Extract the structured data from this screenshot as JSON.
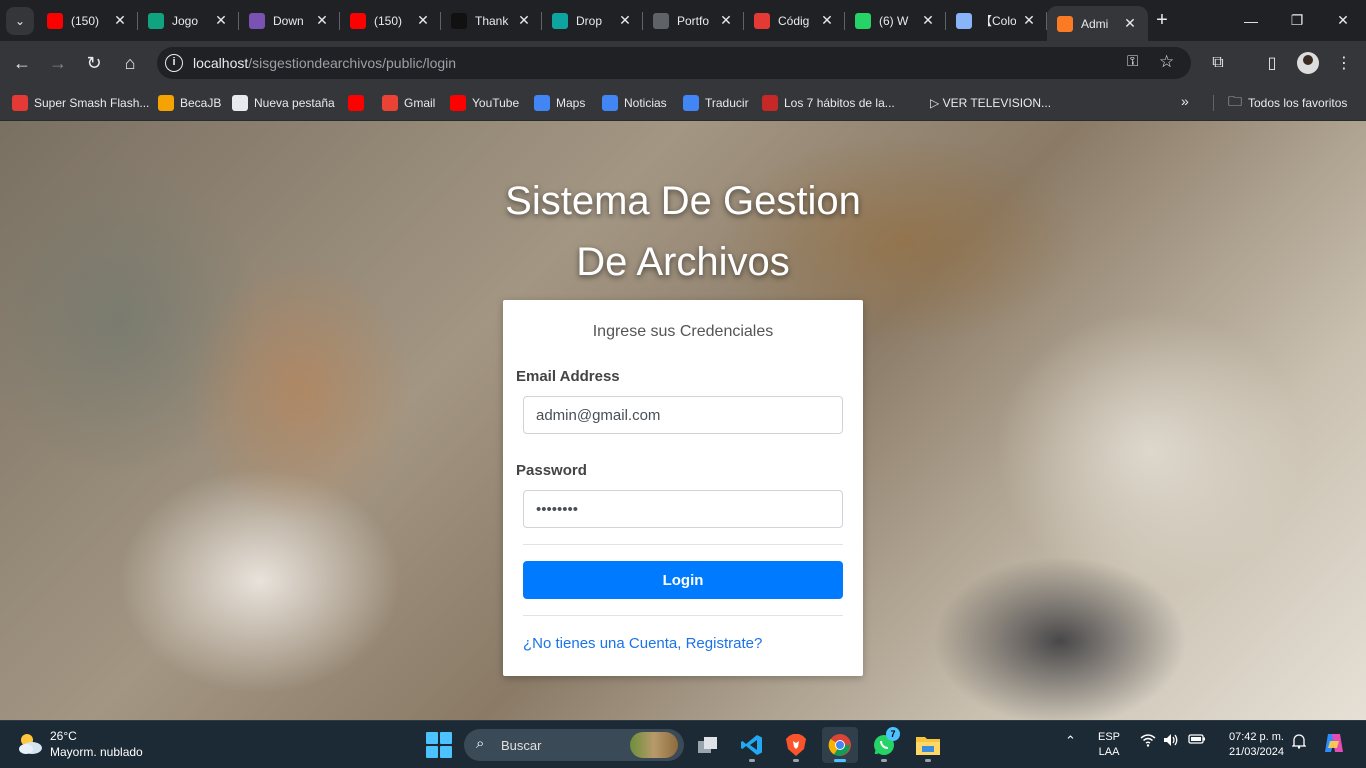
{
  "browser": {
    "tabs": [
      {
        "title": "(150)",
        "icon": "youtube-icon",
        "color": "#ff0000"
      },
      {
        "title": "Jogo",
        "icon": "chatgpt-icon",
        "color": "#10a37f"
      },
      {
        "title": "Down",
        "icon": "bootstrap-icon",
        "color": "#7952b3"
      },
      {
        "title": "(150)",
        "icon": "youtube-icon",
        "color": "#ff0000"
      },
      {
        "title": "Thank",
        "icon": "app-icon",
        "color": "#111111"
      },
      {
        "title": "Drop",
        "icon": "diamond-icon",
        "color": "#0ea5a0"
      },
      {
        "title": "Portfo",
        "icon": "globe-icon",
        "color": "#5f6368"
      },
      {
        "title": "Códig",
        "icon": "record-icon",
        "color": "#e53935"
      },
      {
        "title": "(6) W",
        "icon": "whatsapp-icon",
        "color": "#25d366"
      },
      {
        "title": "【Colo",
        "icon": "globe-icon",
        "color": "#8ab4f8"
      },
      {
        "title": "Admi",
        "icon": "xampp-icon",
        "color": "#fb7a24",
        "active": true
      }
    ],
    "url_host": "localhost",
    "url_path": "/sisgestiondearchivos/public/login",
    "bookmarks": [
      {
        "label": "Super Smash Flash...",
        "icon": "smash-icon",
        "color": "#e53935"
      },
      {
        "label": "BecaJB",
        "icon": "becajb-icon",
        "color": "#f4a300"
      },
      {
        "label": "Nueva pestaña",
        "icon": "globe-icon",
        "color": "#e8eaed"
      },
      {
        "label": "",
        "icon": "youtube-icon",
        "color": "#ff0000"
      },
      {
        "label": "Gmail",
        "icon": "gmail-icon",
        "color": "#ea4335"
      },
      {
        "label": "YouTube",
        "icon": "youtube-icon",
        "color": "#ff0000"
      },
      {
        "label": "Maps",
        "icon": "google-icon",
        "color": "#4285f4"
      },
      {
        "label": "Noticias",
        "icon": "news-icon",
        "color": "#4285f4"
      },
      {
        "label": "Traducir",
        "icon": "translate-icon",
        "color": "#4285f4"
      },
      {
        "label": "Los 7 hábitos de la...",
        "icon": "pdf-icon",
        "color": "#c62828"
      },
      {
        "label": "▷ VER TELEVISION...",
        "icon": "",
        "color": ""
      }
    ],
    "all_bookmarks": "Todos los favoritos"
  },
  "page": {
    "title_line1": "Sistema De Gestion",
    "title_line2": "De Archivos",
    "subtitle": "Ingrese sus Credenciales",
    "email_label": "Email Address",
    "email_value": "admin@gmail.com",
    "password_label": "Password",
    "password_value": "••••••••",
    "login_button": "Login",
    "register_link": "¿No tienes una Cuenta, Registrate?",
    "accent_color": "#007bff"
  },
  "taskbar": {
    "temperature": "26°C",
    "weather": "Mayorm. nublado",
    "search_placeholder": "Buscar",
    "whatsapp_badge": "7",
    "lang_line1": "ESP",
    "lang_line2": "LAA",
    "time": "07:42 p. m.",
    "date": "21/03/2024"
  }
}
